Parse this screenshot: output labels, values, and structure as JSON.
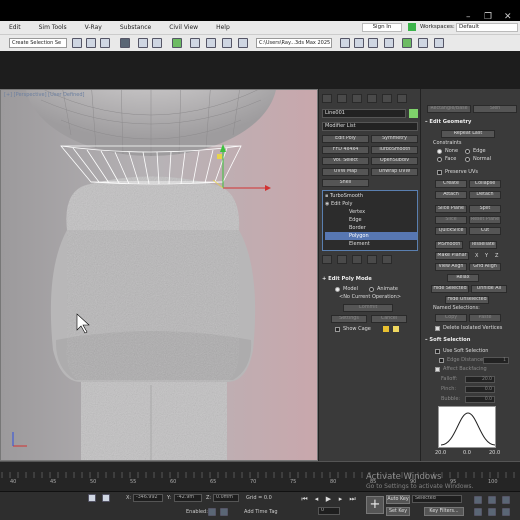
{
  "menu": {
    "items": [
      "Edit",
      "Sim Tools",
      "V-Ray",
      "Substance",
      "Civil View",
      "Help"
    ],
    "sign_in": "Sign In",
    "workspaces_label": "Workspaces:",
    "workspace_value": "Default"
  },
  "toolbar": {
    "selection_filter": "Create Selection Se",
    "path": "C:\\Users\\Ray...3ds Max 2025"
  },
  "viewport": {
    "label": "[+] [Perspective] [User Defined]"
  },
  "command_panel": {
    "object_name": "Line001",
    "object_color": "#7fd36b",
    "modifier_list": "Modifier List",
    "modifier_buttons": [
      [
        "Edit Poly",
        "Symmetry"
      ],
      [
        "FFD 4x4x4",
        "TurboSmooth"
      ],
      [
        "Vol. Select",
        "OpenSubdiv"
      ],
      [
        "UVW Map",
        "Unwrap UVW"
      ],
      [
        "Shell",
        ""
      ]
    ],
    "stack": [
      "TurboSmooth",
      "Edit Poly",
      "Vertex",
      "Edge",
      "Border",
      "Polygon",
      "Element"
    ],
    "edit_poly_mode": {
      "header": "Edit Poly Mode",
      "model": "Model",
      "animate": "Animate",
      "current_op": "<No Current Operation>",
      "commit": "Commit",
      "settings": "Settings",
      "cancel": "Cancel",
      "show_cage": "Show Cage"
    }
  },
  "right_panel": {
    "top_buttons": [
      "Rectangle/Base",
      "Slen"
    ],
    "edit_geometry": {
      "header": "Edit Geometry",
      "repeat_last": "Repeat Last",
      "constraints": "Constraints",
      "none": "None",
      "edge": "Edge",
      "face": "Face",
      "normal": "Normal",
      "preserve_uvs": "Preserve UVs",
      "create": "Create",
      "collapse": "Collapse",
      "attach": "Attach",
      "detach": "Detach",
      "slice_plane": "Slice Plane",
      "split": "Split",
      "slice": "Slice",
      "reset_plane": "Reset Plane",
      "quickslice": "QuickSlice",
      "cut": "Cut",
      "msmooth": "MSmooth",
      "tessellate": "Tessellate",
      "make_planar": "Make Planar",
      "xyz": [
        "X",
        "Y",
        "Z"
      ],
      "view_align": "View Align",
      "grid_align": "Grid Align",
      "relax": "Relax",
      "hide_selected": "Hide Selected",
      "unhide_all": "Unhide All",
      "hide_unselected": "Hide Unselected",
      "named_selections": "Named Selections:",
      "copy": "Copy",
      "paste": "Paste",
      "delete_isolated": "Delete Isolated Vertices"
    },
    "soft_selection": {
      "header": "Soft Selection",
      "use_soft": "Use Soft Selection",
      "edge_distance": "Edge Distance:",
      "edge_distance_val": "1",
      "affect_backfacing": "Affect Backfacing",
      "falloff": "Falloff:",
      "falloff_val": "20.0",
      "pinch": "Pinch:",
      "pinch_val": "0.0",
      "bubble": "Bubble:",
      "bubble_val": "0.0",
      "curve_labels": [
        "20.0",
        "0.0",
        "20.0"
      ]
    }
  },
  "timeline": {
    "ticks": [
      "40",
      "45",
      "50",
      "55",
      "60",
      "65",
      "70",
      "75",
      "80",
      "85",
      "90",
      "95",
      "100"
    ]
  },
  "status": {
    "x_label": "X:",
    "x_value": "-346.992",
    "y_label": "Y:",
    "y_value": "-42.9m",
    "z_label": "Z:",
    "z_value": "0.0mm",
    "grid": "Grid = 0.0",
    "enabled_label": "Enabled:",
    "add_time_tag": "Add Time Tag",
    "auto_key": "Auto Key",
    "selected": "Selected",
    "set_key": "Set Key",
    "key_filters": "Key Filters...",
    "frame": "0"
  },
  "watermark": {
    "title": "Activate Windows",
    "subtitle": "Go to Settings to activate Windows."
  },
  "colors": {
    "accent_blue": "#5777b2",
    "bg_panel": "#3a3a3a",
    "menu_bg": "#e9e9e9",
    "axis_red": "#d23232",
    "axis_green": "#3cc03c",
    "gizmo_yellow": "#e8d44a"
  }
}
